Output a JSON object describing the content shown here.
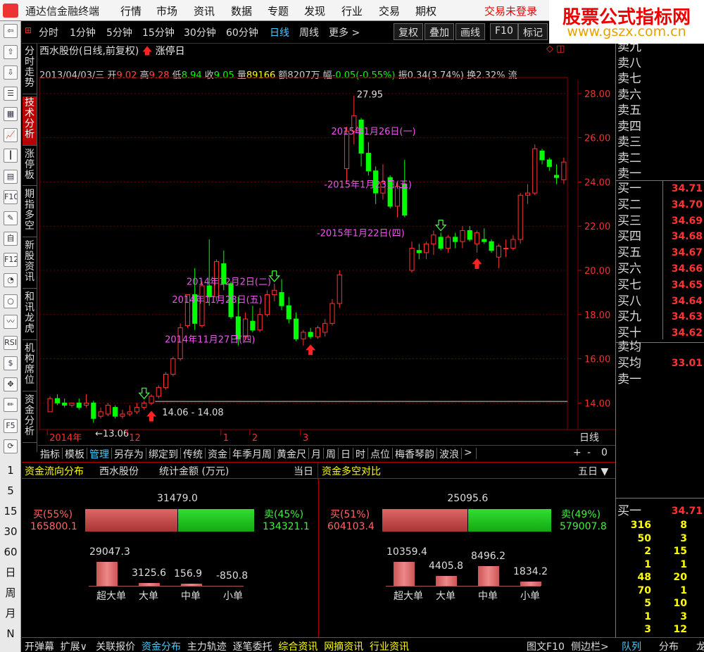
{
  "app": {
    "title": "通达信金融终端",
    "menu": [
      "行情",
      "市场",
      "资讯",
      "数据",
      "专题",
      "发现",
      "行业",
      "交易",
      "期权"
    ],
    "login": "交易未登录"
  },
  "watermark": {
    "line1": "股票公式指标网",
    "line2": "www.gszx.com.cn"
  },
  "timeframes": [
    "分时",
    "1分钟",
    "5分钟",
    "15分钟",
    "30分钟",
    "60分钟",
    "日线",
    "周线",
    "更多 >"
  ],
  "selected_timeframe": "日线",
  "toolbar_buttons": [
    "复权",
    "叠加",
    "画线",
    "F10",
    "标记"
  ],
  "left_icons": [
    "back-arrow",
    "up-arrow",
    "down-arrow",
    "list",
    "grid",
    "line-chart",
    "kline",
    "table",
    "f10",
    "note",
    "self",
    "f12",
    "clock",
    "circle",
    "wave",
    "rsi",
    "dollar",
    "move",
    "pen",
    "f5",
    "refresh"
  ],
  "left_labels": [
    "1",
    "5",
    "15",
    "30",
    "60",
    "日",
    "周",
    "月",
    "N"
  ],
  "vertical_tabs": [
    "分时走势",
    "技术分析",
    "涨停板",
    "期指多空",
    "新股资讯",
    "和讯龙虎",
    "机构席位",
    "资金分析"
  ],
  "selected_vtab": "技术分析",
  "stock": {
    "title": "西水股份(日线,前复权)",
    "badge": "涨停日"
  },
  "info": {
    "date": "2013/04/03/三",
    "open_label": "开",
    "open": "9.02",
    "high_label": "高",
    "high": "9.28",
    "low_label": "低",
    "low": "8.94",
    "close_label": "收",
    "close": "9.05",
    "vol_label": "量",
    "vol": "89166",
    "amt_label": "额",
    "amt": "8207万",
    "chg_label": "幅",
    "chg": "-0.05(-0.55%)",
    "amp_label": "振",
    "amp": "0.34(3.74%)",
    "turn_label": "换",
    "turn": "2.32%",
    "tail": "流"
  },
  "chart_data": {
    "type": "candlestick",
    "y_ticks": [
      "28.00",
      "26.00",
      "24.00",
      "22.00",
      "20.00",
      "18.00",
      "16.00",
      "14.00"
    ],
    "ylim": [
      12.8,
      28.6
    ],
    "x_labels": [
      "2014年",
      "12",
      "1",
      "2",
      "3"
    ],
    "x_label_at": [
      0,
      11,
      24,
      28,
      35
    ],
    "timeframe_label": "日线",
    "candles": [
      {
        "o": 13.6,
        "h": 14.3,
        "l": 13.6,
        "c": 14.2
      },
      {
        "o": 14.2,
        "h": 14.4,
        "l": 13.9,
        "c": 14.0
      },
      {
        "o": 14.0,
        "h": 14.2,
        "l": 13.8,
        "c": 13.9
      },
      {
        "o": 13.9,
        "h": 14.0,
        "l": 13.8,
        "c": 14.0
      },
      {
        "o": 14.0,
        "h": 14.2,
        "l": 13.7,
        "c": 13.8
      },
      {
        "o": 13.9,
        "h": 14.4,
        "l": 13.8,
        "c": 14.0
      },
      {
        "o": 14.0,
        "h": 14.1,
        "l": 13.1,
        "c": 13.3
      },
      {
        "o": 13.4,
        "h": 13.8,
        "l": 13.3,
        "c": 13.6
      },
      {
        "o": 13.5,
        "h": 14.0,
        "l": 13.4,
        "c": 13.9
      },
      {
        "o": 13.8,
        "h": 13.9,
        "l": 13.3,
        "c": 13.4
      },
      {
        "o": 13.4,
        "h": 13.7,
        "l": 13.3,
        "c": 13.5
      },
      {
        "o": 13.5,
        "h": 13.9,
        "l": 13.4,
        "c": 13.6
      },
      {
        "o": 13.6,
        "h": 14.0,
        "l": 13.5,
        "c": 13.8
      },
      {
        "o": 13.8,
        "h": 14.1,
        "l": 13.7,
        "c": 14.0
      },
      {
        "o": 14.0,
        "h": 14.4,
        "l": 13.9,
        "c": 14.3
      },
      {
        "o": 14.3,
        "h": 14.8,
        "l": 14.2,
        "c": 14.7
      },
      {
        "o": 14.7,
        "h": 15.4,
        "l": 14.6,
        "c": 15.3
      },
      {
        "o": 15.3,
        "h": 16.1,
        "l": 15.2,
        "c": 16.0
      },
      {
        "o": 16.0,
        "h": 17.6,
        "l": 15.9,
        "c": 17.4
      },
      {
        "o": 17.5,
        "h": 18.9,
        "l": 17.4,
        "c": 18.9
      },
      {
        "o": 18.9,
        "h": 20.1,
        "l": 17.3,
        "c": 17.6
      },
      {
        "o": 17.5,
        "h": 19.5,
        "l": 17.4,
        "c": 19.3
      },
      {
        "o": 19.3,
        "h": 21.4,
        "l": 18.4,
        "c": 18.8
      },
      {
        "o": 18.8,
        "h": 20.5,
        "l": 18.6,
        "c": 20.4
      },
      {
        "o": 20.3,
        "h": 20.9,
        "l": 19.1,
        "c": 19.4
      },
      {
        "o": 19.4,
        "h": 19.5,
        "l": 17.8,
        "c": 17.9
      },
      {
        "o": 17.9,
        "h": 18.8,
        "l": 16.6,
        "c": 16.9
      },
      {
        "o": 17.0,
        "h": 18.1,
        "l": 16.9,
        "c": 17.8
      },
      {
        "o": 17.7,
        "h": 18.4,
        "l": 17.2,
        "c": 17.3
      },
      {
        "o": 17.3,
        "h": 18.3,
        "l": 17.2,
        "c": 18.0
      },
      {
        "o": 18.0,
        "h": 19.1,
        "l": 17.9,
        "c": 18.9
      },
      {
        "o": 18.9,
        "h": 19.4,
        "l": 18.6,
        "c": 19.1
      },
      {
        "o": 19.0,
        "h": 19.6,
        "l": 18.2,
        "c": 18.4
      },
      {
        "o": 18.4,
        "h": 18.8,
        "l": 17.6,
        "c": 17.8
      },
      {
        "o": 17.8,
        "h": 18.1,
        "l": 16.8,
        "c": 16.9
      },
      {
        "o": 16.9,
        "h": 17.3,
        "l": 16.6,
        "c": 17.2
      },
      {
        "o": 17.2,
        "h": 17.4,
        "l": 16.9,
        "c": 17.0
      },
      {
        "o": 17.0,
        "h": 17.5,
        "l": 16.9,
        "c": 17.4
      },
      {
        "o": 17.2,
        "h": 17.8,
        "l": 17.0,
        "c": 17.6
      },
      {
        "o": 17.6,
        "h": 18.7,
        "l": 17.5,
        "c": 18.5
      },
      {
        "o": 18.5,
        "h": 20.0,
        "l": 18.3,
        "c": 19.8
      },
      {
        "o": 24.6,
        "h": 26.5,
        "l": 24.0,
        "c": 26.3
      },
      {
        "o": 26.3,
        "h": 27.9,
        "l": 25.7,
        "c": 27.0
      },
      {
        "o": 26.8,
        "h": 26.9,
        "l": 24.7,
        "c": 25.3
      },
      {
        "o": 25.3,
        "h": 25.8,
        "l": 24.3,
        "c": 24.5
      },
      {
        "o": 24.5,
        "h": 24.7,
        "l": 23.0,
        "c": 23.5
      },
      {
        "o": 23.5,
        "h": 24.8,
        "l": 23.2,
        "c": 24.0
      },
      {
        "o": 24.2,
        "h": 24.3,
        "l": 22.8,
        "c": 22.9
      },
      {
        "o": 22.9,
        "h": 24.0,
        "l": 22.4,
        "c": 23.8
      },
      {
        "o": 23.9,
        "h": 25.0,
        "l": 22.4,
        "c": 22.5
      },
      {
        "o": 20.0,
        "h": 21.3,
        "l": 19.9,
        "c": 21.0
      },
      {
        "o": 20.9,
        "h": 21.2,
        "l": 20.5,
        "c": 20.8
      },
      {
        "o": 20.8,
        "h": 21.3,
        "l": 20.5,
        "c": 21.2
      },
      {
        "o": 21.2,
        "h": 21.8,
        "l": 20.7,
        "c": 21.6
      },
      {
        "o": 21.5,
        "h": 21.7,
        "l": 20.9,
        "c": 21.0
      },
      {
        "o": 21.0,
        "h": 21.6,
        "l": 20.8,
        "c": 21.5
      },
      {
        "o": 21.5,
        "h": 21.7,
        "l": 21.0,
        "c": 21.3
      },
      {
        "o": 21.3,
        "h": 22.0,
        "l": 21.0,
        "c": 21.8
      },
      {
        "o": 21.8,
        "h": 22.0,
        "l": 21.3,
        "c": 21.4
      },
      {
        "o": 21.2,
        "h": 21.8,
        "l": 20.8,
        "c": 21.7
      },
      {
        "o": 21.4,
        "h": 21.9,
        "l": 21.2,
        "c": 21.3
      },
      {
        "o": 21.3,
        "h": 21.4,
        "l": 20.8,
        "c": 20.9
      },
      {
        "o": 20.6,
        "h": 21.2,
        "l": 20.1,
        "c": 21.1
      },
      {
        "o": 21.0,
        "h": 21.4,
        "l": 20.6,
        "c": 21.0
      },
      {
        "o": 21.0,
        "h": 21.6,
        "l": 20.9,
        "c": 21.4
      },
      {
        "o": 21.4,
        "h": 23.5,
        "l": 21.2,
        "c": 23.4
      },
      {
        "o": 23.4,
        "h": 23.9,
        "l": 23.0,
        "c": 23.5
      },
      {
        "o": 23.5,
        "h": 25.7,
        "l": 23.4,
        "c": 25.5
      },
      {
        "o": 25.4,
        "h": 25.5,
        "l": 24.8,
        "c": 25.0
      },
      {
        "o": 25.0,
        "h": 25.1,
        "l": 24.5,
        "c": 24.7
      },
      {
        "o": 24.3,
        "h": 24.8,
        "l": 23.9,
        "c": 24.2
      },
      {
        "o": 24.1,
        "h": 25.1,
        "l": 23.9,
        "c": 24.9
      }
    ],
    "annotations": [
      {
        "text": "2015年1月26日(一)",
        "i": 41,
        "y": 26.3
      },
      {
        "text": "-2015年1月23日(五)",
        "i": 40,
        "y": 23.9
      },
      {
        "text": "-2015年1月22日(四)",
        "i": 39,
        "y": 21.7
      },
      {
        "text": "2014年12月2日(二)",
        "i": 21,
        "y": 19.5
      },
      {
        "text": "2014年11月28日(五)",
        "i": 19,
        "y": 18.7
      },
      {
        "text": "2014年11月27日(四)",
        "i": 18,
        "y": 16.9
      }
    ],
    "extremes": [
      {
        "text": "27.95",
        "i": 42,
        "y": 27.95
      },
      {
        "text": "←13.06",
        "i": 7,
        "y": 13.06
      }
    ],
    "range_label": "14.06 - 14.08",
    "hline": 14.07,
    "up_arrows": [
      14,
      36,
      59
    ],
    "green_arrows": [
      13,
      31,
      54
    ]
  },
  "indicator_tabs": [
    "指标",
    "模板",
    "管理",
    "另存为",
    "绑定到",
    "传统",
    "资金",
    "年季月周",
    "黄金尺",
    "月",
    "周",
    "日",
    "时",
    "点位",
    "梅香琴韵",
    "波浪",
    ">"
  ],
  "selected_indicator_tab": "管理",
  "zoom_buttons": [
    "+",
    "-",
    "0"
  ],
  "fund_left": {
    "title": "资金流向分布",
    "stock": "西水股份",
    "stat": "统计金额 (万元)",
    "period": "当日",
    "total": "31479.0",
    "buy_label": "买(55%)",
    "buy": "165800.1",
    "sell_label": "卖(45%)",
    "sell": "134321.1",
    "buy_frac": 0.55,
    "bars": [
      {
        "label": "超大单",
        "value": "29047.3",
        "v": 29047.3
      },
      {
        "label": "大单",
        "value": "3125.6",
        "v": 3125.6
      },
      {
        "label": "中单",
        "value": "156.9",
        "v": 156.9
      },
      {
        "label": "小单",
        "value": "-850.8",
        "v": -850.8
      }
    ],
    "small_header": "小单"
  },
  "fund_right": {
    "title": "资金多空对比",
    "period": "五日 ▼",
    "total": "25095.6",
    "buy_label": "买(51%)",
    "buy": "604103.4",
    "sell_label": "卖(49%)",
    "sell": "579007.8",
    "buy_frac": 0.51,
    "bars": [
      {
        "label": "超大单",
        "value": "10359.4",
        "v": 10359.4
      },
      {
        "label": "大单",
        "value": "4405.8",
        "v": 4405.8
      },
      {
        "label": "中单",
        "value": "8496.2",
        "v": 8496.2
      },
      {
        "label": "小单",
        "value": "1834.2",
        "v": 1834.2
      }
    ]
  },
  "orderbook": {
    "sell": [
      "卖九",
      "卖八",
      "卖七",
      "卖六",
      "卖五",
      "卖四",
      "卖三",
      "卖二",
      "卖一"
    ],
    "buy": [
      {
        "l": "买一",
        "v": "34.71"
      },
      {
        "l": "买二",
        "v": "34.70"
      },
      {
        "l": "买三",
        "v": "34.69"
      },
      {
        "l": "买四",
        "v": "34.68"
      },
      {
        "l": "买五",
        "v": "34.67"
      },
      {
        "l": "买六",
        "v": "34.66"
      },
      {
        "l": "买七",
        "v": "34.65"
      },
      {
        "l": "买八",
        "v": "34.64"
      },
      {
        "l": "买九",
        "v": "34.63"
      },
      {
        "l": "买十",
        "v": "34.62"
      }
    ],
    "avg_sell": "卖均",
    "avg_buy": "买均",
    "avg_buy_val": "33.01",
    "sell1": "卖一",
    "queue_label": "买一",
    "queue_val": "34.71",
    "queue": [
      [
        "316",
        "8"
      ],
      [
        "50",
        "3"
      ],
      [
        "2",
        "15"
      ],
      [
        "1",
        "1"
      ],
      [
        "48",
        "20"
      ],
      [
        "70",
        "1"
      ],
      [
        "5",
        "10"
      ],
      [
        "1",
        "3"
      ],
      [
        "3",
        "12"
      ]
    ]
  },
  "status_bar": {
    "items": [
      "开弹幕",
      "扩展∨",
      "关联报价",
      "资金分布",
      "主力轨迹",
      "逐笔委托"
    ],
    "info_items": [
      "综合资讯",
      "网摘资讯",
      "行业资讯"
    ],
    "right_items": [
      "图文F10",
      "侧边栏>"
    ],
    "tabs": [
      "队列",
      "分布",
      "龙"
    ],
    "selected": "资金分布",
    "selected_tab": "队列"
  }
}
